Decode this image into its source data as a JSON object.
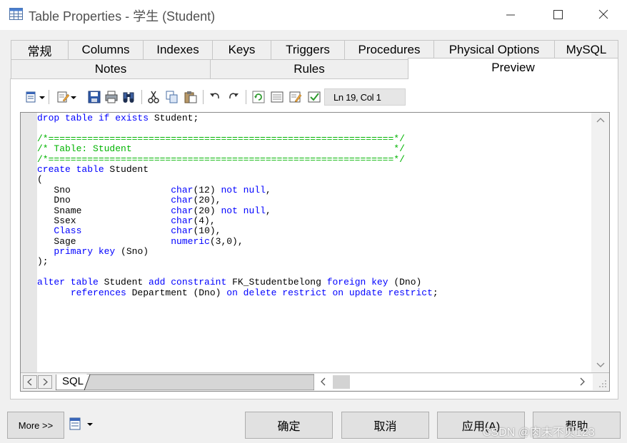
{
  "window": {
    "title": "Table Properties - 学生 (Student)",
    "icons": {
      "app": "table-grid-icon",
      "minimize": "minimize-icon",
      "maximize": "maximize-icon",
      "close": "close-icon"
    }
  },
  "tabs_row1": [
    "常规",
    "Columns",
    "Indexes",
    "Keys",
    "Triggers",
    "Procedures",
    "Physical Options",
    "MySQL"
  ],
  "tabs_row2": [
    "Notes",
    "Rules",
    "Preview"
  ],
  "active_tab": "Preview",
  "toolbar": {
    "icons": [
      "script-dropdown-icon",
      "edit-dropdown-icon",
      "save-icon",
      "print-icon",
      "find-icon",
      "cut-icon",
      "copy-icon",
      "paste-icon",
      "undo-icon",
      "redo-icon",
      "refresh-icon",
      "properties-icon",
      "edit-icon",
      "check-icon"
    ],
    "position_label": "Ln 19, Col 1"
  },
  "code": {
    "lines": [
      [
        {
          "t": "drop table if exists",
          "c": "kw"
        },
        {
          "t": " Student;",
          "c": ""
        }
      ],
      [],
      [
        {
          "t": "/*==============================================================*/",
          "c": "cm"
        }
      ],
      [
        {
          "t": "/* Table: Student                                               */",
          "c": "cm"
        }
      ],
      [
        {
          "t": "/*==============================================================*/",
          "c": "cm"
        }
      ],
      [
        {
          "t": "create table",
          "c": "kw"
        },
        {
          "t": " Student",
          "c": ""
        }
      ],
      [
        {
          "t": "(",
          "c": ""
        }
      ],
      [
        {
          "t": "   Sno                  ",
          "c": ""
        },
        {
          "t": "char",
          "c": "kw"
        },
        {
          "t": "(12) ",
          "c": ""
        },
        {
          "t": "not null",
          "c": "kw"
        },
        {
          "t": ",",
          "c": ""
        }
      ],
      [
        {
          "t": "   Dno                  ",
          "c": ""
        },
        {
          "t": "char",
          "c": "kw"
        },
        {
          "t": "(20),",
          "c": ""
        }
      ],
      [
        {
          "t": "   Sname                ",
          "c": ""
        },
        {
          "t": "char",
          "c": "kw"
        },
        {
          "t": "(20) ",
          "c": ""
        },
        {
          "t": "not null",
          "c": "kw"
        },
        {
          "t": ",",
          "c": ""
        }
      ],
      [
        {
          "t": "   Ssex                 ",
          "c": ""
        },
        {
          "t": "char",
          "c": "kw"
        },
        {
          "t": "(4),",
          "c": ""
        }
      ],
      [
        {
          "t": "   ",
          "c": ""
        },
        {
          "t": "Class",
          "c": "kw"
        },
        {
          "t": "                ",
          "c": ""
        },
        {
          "t": "char",
          "c": "kw"
        },
        {
          "t": "(10),",
          "c": ""
        }
      ],
      [
        {
          "t": "   Sage                 ",
          "c": ""
        },
        {
          "t": "numeric",
          "c": "kw"
        },
        {
          "t": "(3,0),",
          "c": ""
        }
      ],
      [
        {
          "t": "   ",
          "c": ""
        },
        {
          "t": "primary key",
          "c": "kw"
        },
        {
          "t": " (Sno)",
          "c": ""
        }
      ],
      [
        {
          "t": ");",
          "c": ""
        }
      ],
      [],
      [
        {
          "t": "alter table",
          "c": "kw"
        },
        {
          "t": " Student ",
          "c": ""
        },
        {
          "t": "add constraint",
          "c": "kw"
        },
        {
          "t": " FK_Studentbelong ",
          "c": ""
        },
        {
          "t": "foreign key",
          "c": "kw"
        },
        {
          "t": " (Dno)",
          "c": ""
        }
      ],
      [
        {
          "t": "      ",
          "c": ""
        },
        {
          "t": "references",
          "c": "kw"
        },
        {
          "t": " Department (Dno) ",
          "c": ""
        },
        {
          "t": "on delete restrict on update restrict",
          "c": "kw"
        },
        {
          "t": ";",
          "c": ""
        }
      ]
    ]
  },
  "editor_tabs": {
    "sql_tab": "SQL"
  },
  "buttons": {
    "more": "More >>",
    "ok": "确定",
    "cancel": "取消",
    "apply": "应用(A)",
    "help": "帮助"
  },
  "watermark": "CSDN @肉末不贝123",
  "colors": {
    "keyword": "#0000ff",
    "comment": "#00b400",
    "dialog_bg": "#f0f0f0"
  }
}
